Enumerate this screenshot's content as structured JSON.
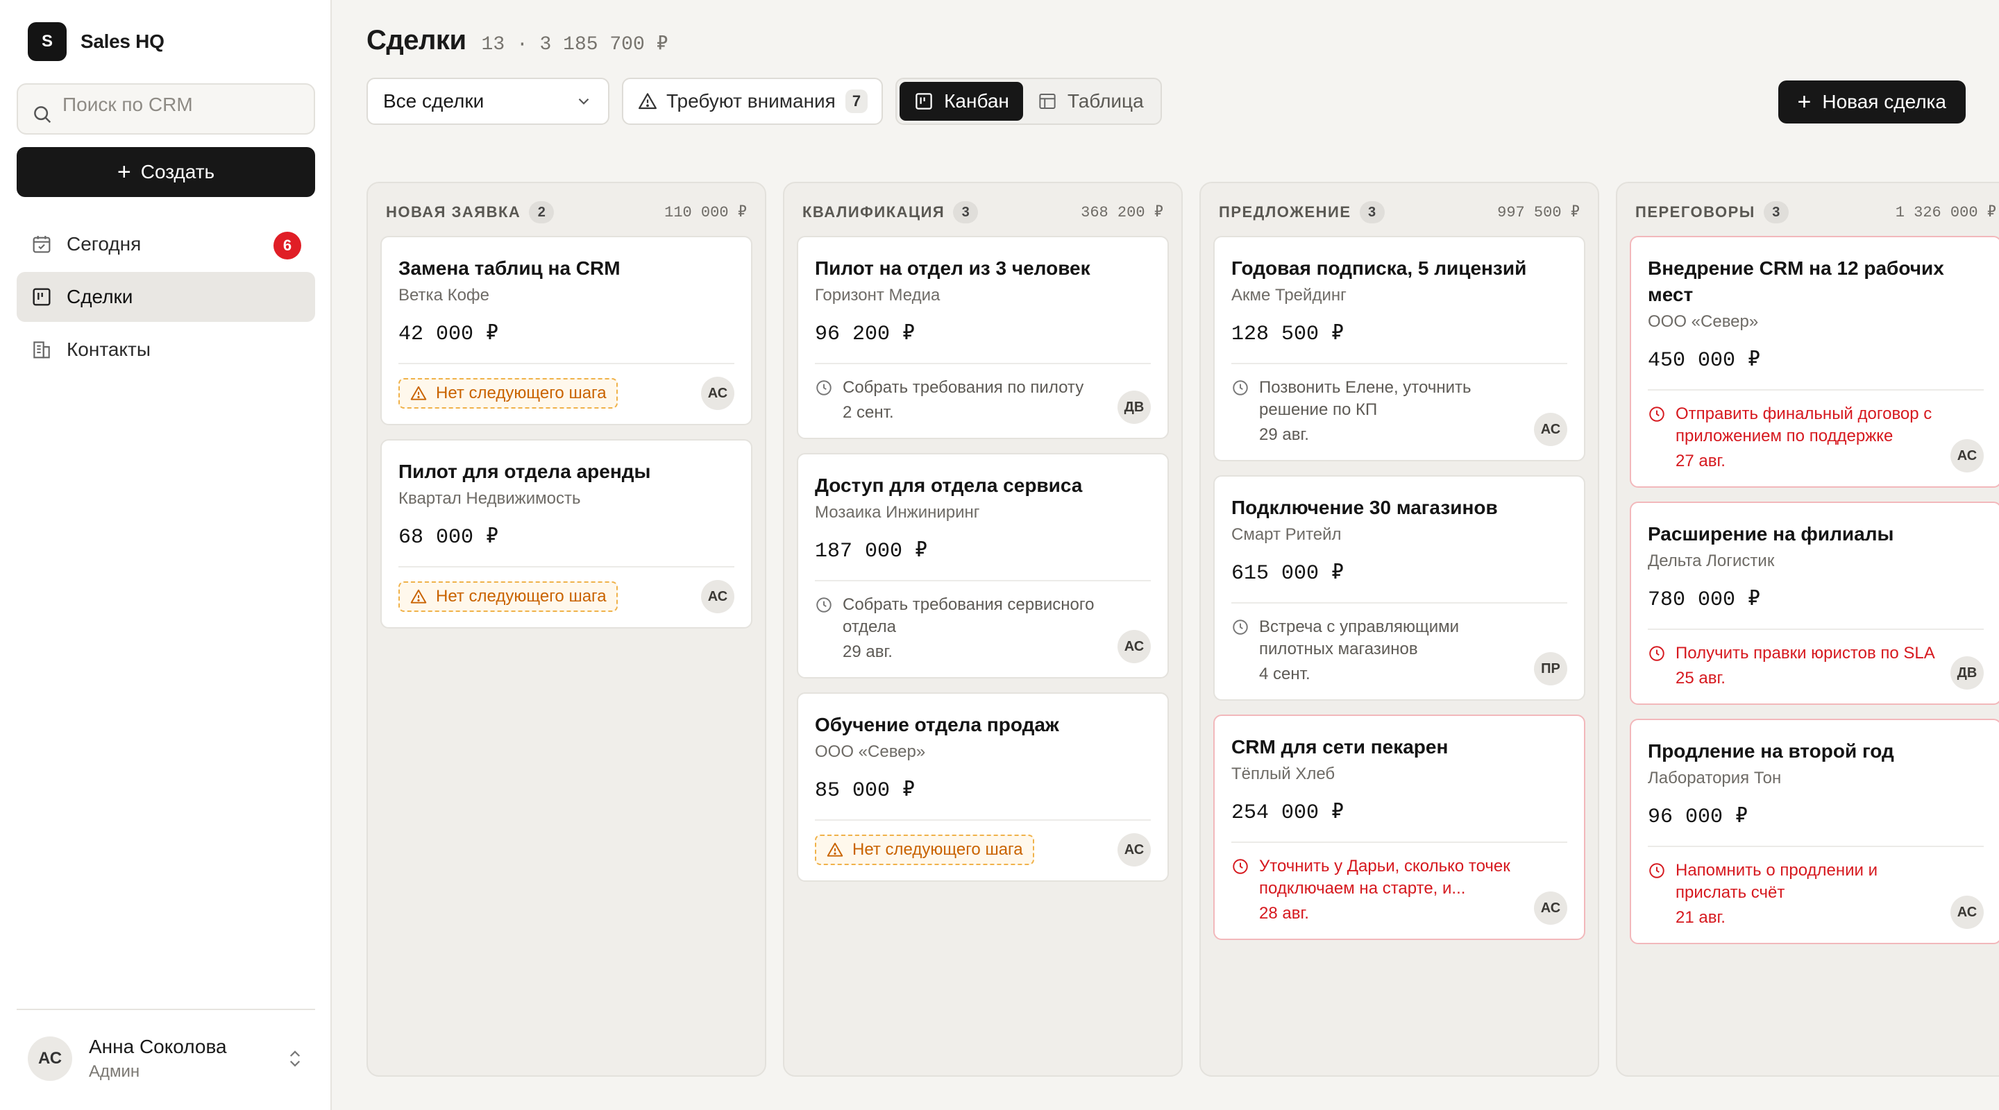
{
  "brand": {
    "logo_letter": "S",
    "name": "Sales HQ"
  },
  "search": {
    "placeholder": "Поиск по CRM"
  },
  "sidebar": {
    "create_label": "Создать",
    "items": [
      {
        "label": "Сегодня",
        "icon": "calendar-icon",
        "badge": "6"
      },
      {
        "label": "Сделки",
        "icon": "kanban-icon",
        "active": true
      },
      {
        "label": "Контакты",
        "icon": "building-icon"
      }
    ]
  },
  "user": {
    "initials": "АС",
    "name": "Анна Соколова",
    "role": "Админ"
  },
  "header": {
    "title": "Сделки",
    "meta": "13 · 3 185 700 ₽",
    "filter_select": "Все сделки",
    "attention_label": "Требуют внимания",
    "attention_count": "7",
    "view_kanban": "Канбан",
    "view_table": "Таблица",
    "new_deal": "Новая сделка"
  },
  "colors": {
    "accent": "#171717",
    "danger": "#d6191f",
    "warning": "#c96300",
    "badge": "#e01e26"
  },
  "columns": [
    {
      "title": "Новая заявка",
      "count": "2",
      "sum": "110 000 ₽",
      "cards": [
        {
          "title": "Замена таблиц на CRM",
          "company": "Ветка Кофе",
          "amount": "42 000 ₽",
          "warning": "Нет следующего шага",
          "owner": "АС"
        },
        {
          "title": "Пилот для отдела аренды",
          "company": "Квартал Недвижимость",
          "amount": "68 000 ₽",
          "warning": "Нет следующего шага",
          "owner": "АС"
        }
      ]
    },
    {
      "title": "Квалификация",
      "count": "3",
      "sum": "368 200 ₽",
      "cards": [
        {
          "title": "Пилот на отдел из 3 человек",
          "company": "Горизонт Медиа",
          "amount": "96 200 ₽",
          "task": "Собрать требования по пилоту",
          "date": "2 сент.",
          "owner": "ДВ"
        },
        {
          "title": "Доступ для отдела сервиса",
          "company": "Мозаика Инжиниринг",
          "amount": "187 000 ₽",
          "task": "Собрать требования сервисного отдела",
          "date": "29 авг.",
          "owner": "АС"
        },
        {
          "title": "Обучение отдела продаж",
          "company": "ООО «Север»",
          "amount": "85 000 ₽",
          "warning": "Нет следующего шага",
          "owner": "АС"
        }
      ]
    },
    {
      "title": "Предложение",
      "count": "3",
      "sum": "997 500 ₽",
      "cards": [
        {
          "title": "Годовая подписка, 5 лицензий",
          "company": "Акме Трейдинг",
          "amount": "128 500 ₽",
          "task": "Позвонить Елене, уточнить решение по КП",
          "date": "29 авг.",
          "owner": "АС"
        },
        {
          "title": "Подключение 30 магазинов",
          "company": "Смарт Ритейл",
          "amount": "615 000 ₽",
          "task": "Встреча с управляющими пилотных магазинов",
          "date": "4 сент.",
          "owner": "ПР"
        },
        {
          "title": "CRM для сети пекарен",
          "company": "Тёплый Хлеб",
          "amount": "254 000 ₽",
          "task": "Уточнить у Дарьи, сколько точек подключаем на старте, и...",
          "date": "28 авг.",
          "owner": "АС",
          "overdue": true
        }
      ]
    },
    {
      "title": "Переговоры",
      "count": "3",
      "sum": "1 326 000 ₽",
      "cards": [
        {
          "title": "Внедрение CRM на 12 рабочих мест",
          "company": "ООО «Север»",
          "amount": "450 000 ₽",
          "task": "Отправить финальный договор с приложением по поддержке",
          "date": "27 авг.",
          "owner": "АС",
          "overdue": true
        },
        {
          "title": "Расширение на филиалы",
          "company": "Дельта Логистик",
          "amount": "780 000 ₽",
          "task": "Получить правки юристов по SLA",
          "date": "25 авг.",
          "owner": "ДВ",
          "overdue": true
        },
        {
          "title": "Продление на второй год",
          "company": "Лаборатория Тон",
          "amount": "96 000 ₽",
          "task": "Напомнить о продлении и прислать счёт",
          "date": "21 авг.",
          "owner": "АС",
          "overdue": true
        }
      ]
    }
  ]
}
